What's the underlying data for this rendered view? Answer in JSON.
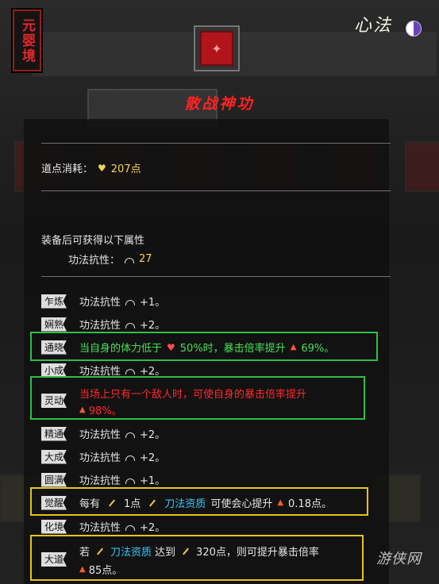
{
  "realm": "元婴境",
  "header_title": "心法",
  "skill_name": "散战神功",
  "cost": {
    "label": "道点消耗：",
    "value": "207点"
  },
  "attributes": {
    "heading": "装备后可获得以下属性",
    "stat_label": "功法抗性：",
    "stat_value": "27"
  },
  "levels": [
    {
      "badge": "乍炼",
      "text": "功法抗性",
      "value": "+1。"
    },
    {
      "badge": "娴熟",
      "text": "功法抗性",
      "value": "+2。"
    },
    {
      "badge": "通晓",
      "pre": "当自身的体力低于",
      "pct": "50%时，暴击倍率提升",
      "rate": "69%。"
    },
    {
      "badge": "小成",
      "text": "功法抗性",
      "value": "+2。"
    },
    {
      "badge": "灵动",
      "line1": "当场上只有一个敌人时，可使自身的暴击倍率提升",
      "rate": "98%。"
    },
    {
      "badge": "精通",
      "text": "功法抗性",
      "value": "+2。"
    },
    {
      "badge": "大成",
      "text": "功法抗性",
      "value": "+2。"
    },
    {
      "badge": "圆满",
      "text": "功法抗性",
      "value": "+1。"
    },
    {
      "badge": "觉醒",
      "w1": "每有",
      "n1": "1点",
      "res": "刀法资质",
      "w2": "可使会心提升",
      "rate": "0.18点。"
    },
    {
      "badge": "化境",
      "text": "功法抗性",
      "value": "+2。"
    },
    {
      "badge": "大道",
      "w1": "若",
      "res": "刀法资质",
      "w2": "达到",
      "n1": "320点，则可提升暴击倍率",
      "rate": "85点。"
    }
  ],
  "watermark": "游侠网",
  "colors": {
    "accent_red": "#ff2222",
    "green": "#47e05a",
    "yellow": "#e3c61b",
    "cyan": "#37c9ff"
  }
}
